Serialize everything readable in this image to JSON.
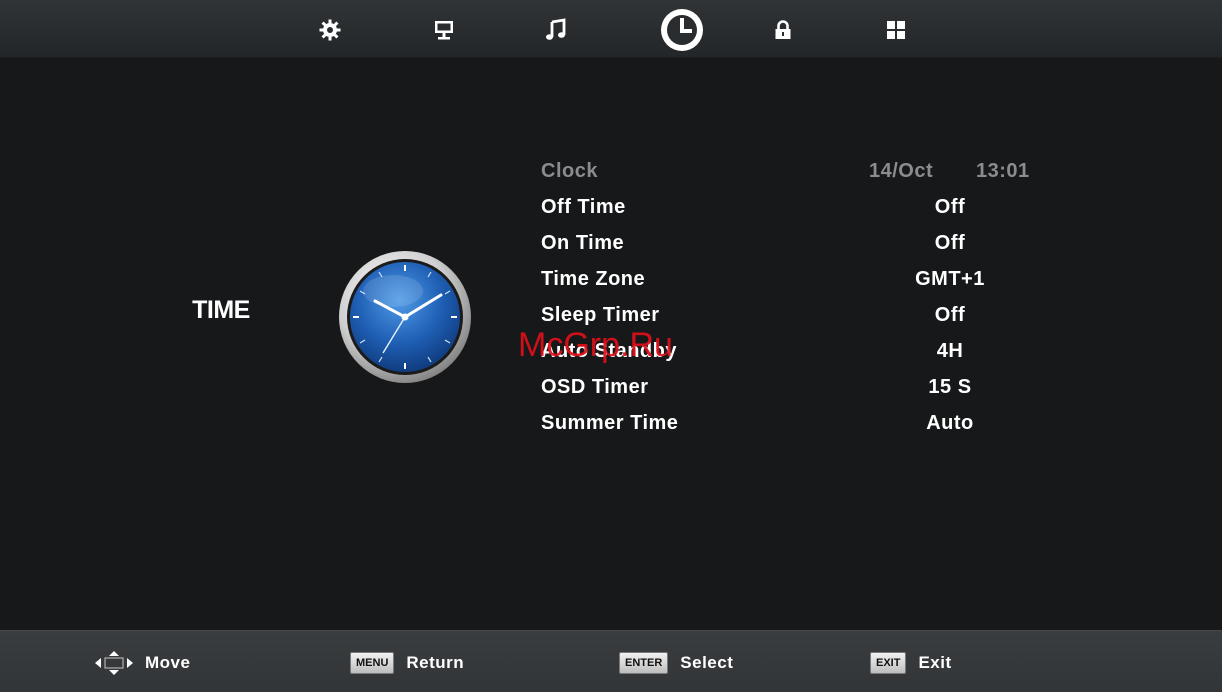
{
  "tabs": [
    {
      "icon": "gear-icon"
    },
    {
      "icon": "monitor-icon"
    },
    {
      "icon": "music-note-icon"
    },
    {
      "icon": "clock-icon",
      "selected": true
    },
    {
      "icon": "lock-icon"
    },
    {
      "icon": "grid-icon"
    }
  ],
  "section": {
    "title": "TIME",
    "icon": "analog-clock-icon"
  },
  "menu": {
    "clock": {
      "label": "Clock",
      "date": "14/Oct",
      "time": "13:01",
      "disabled": true
    },
    "items": [
      {
        "label": "Off Time",
        "value": "Off"
      },
      {
        "label": "On Time",
        "value": "Off"
      },
      {
        "label": "Time Zone",
        "value": "GMT+1"
      },
      {
        "label": "Sleep Timer",
        "value": "Off"
      },
      {
        "label": "Auto Standby",
        "value": "4H"
      },
      {
        "label": "OSD Timer",
        "value": "15 S"
      },
      {
        "label": "Summer Time",
        "value": "Auto"
      }
    ]
  },
  "watermark": "McGrp.Ru",
  "footer": {
    "move": {
      "icon": "arrows-icon",
      "label": "Move"
    },
    "return": {
      "key": "MENU",
      "label": "Return"
    },
    "select": {
      "key": "ENTER",
      "label": "Select"
    },
    "exit": {
      "key": "EXIT",
      "label": "Exit"
    }
  },
  "colors": {
    "background": "#161819",
    "disabled_text": "#8a8d8f",
    "watermark": "#e0101a"
  }
}
